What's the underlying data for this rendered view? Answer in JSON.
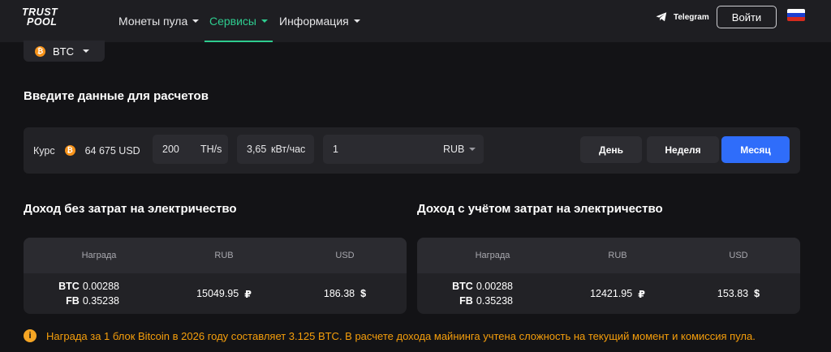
{
  "brand": {
    "logo_line1": "TRUST",
    "logo_line2": "POOL"
  },
  "nav": {
    "items": [
      {
        "label": "Монеты пула"
      },
      {
        "label": "Сервисы"
      },
      {
        "label": "Информация"
      }
    ],
    "active_index": 1
  },
  "header": {
    "telegram_label": "Telegram",
    "login_label": "Войти",
    "language": "ru"
  },
  "coin_selector": {
    "value": "BTC",
    "icon": "bitcoin-icon"
  },
  "calculator": {
    "title": "Введите данные для расчетов",
    "rate_label": "Курс",
    "rate_value": "64 675 USD",
    "hashrate_value": "200",
    "hashrate_unit": "TH/s",
    "power_value": "3,65",
    "power_unit": "кВт/час",
    "price_value": "1",
    "price_currency": "RUB",
    "periods": [
      {
        "label": "День"
      },
      {
        "label": "Неделя"
      },
      {
        "label": "Месяц"
      }
    ],
    "active_period": 2
  },
  "income_gross": {
    "title": "Доход без затрат на электричество",
    "columns": [
      "Награда",
      "RUB",
      "USD"
    ],
    "rewards": [
      {
        "coin": "BTC",
        "amount": "0.00288"
      },
      {
        "coin": "FB",
        "amount": "0.35238"
      }
    ],
    "rub": "15049.95",
    "rub_symbol": "₽",
    "usd": "186.38",
    "usd_symbol": "$"
  },
  "income_net": {
    "title": "Доход с учётом затрат на электричество",
    "columns": [
      "Награда",
      "RUB",
      "USD"
    ],
    "rewards": [
      {
        "coin": "BTC",
        "amount": "0.00288"
      },
      {
        "coin": "FB",
        "amount": "0.35238"
      }
    ],
    "rub": "12421.95",
    "rub_symbol": "₽",
    "usd": "153.83",
    "usd_symbol": "$"
  },
  "notice": {
    "icon": "info-icon",
    "text": "Награда за 1 блок Bitcoin в 2026 году составляет 3.125 BTC. В расчете дохода майнинга учтена сложность на текущий момент и комиссия пула."
  },
  "colors": {
    "accent_green": "#2ecc8f",
    "primary_blue": "#2f6dfa",
    "bitcoin_orange": "#f7931a",
    "warning_orange": "#f59e0b"
  }
}
